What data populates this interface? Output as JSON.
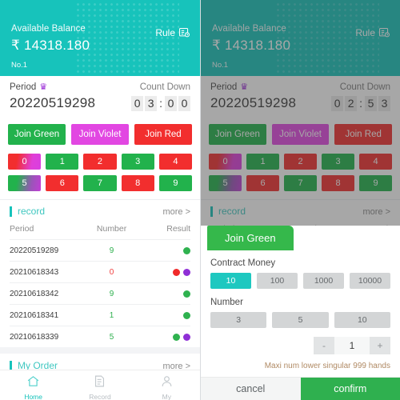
{
  "header": {
    "balance_label": "Available Balance",
    "balance_amount": "₹ 14318.180",
    "account_no": "No.1",
    "rule_label": "Rule",
    "rule_icon": "rule-document-clock-icon"
  },
  "period": {
    "period_label": "Period",
    "crown_icon": "crown-icon",
    "countdown_label": "Count Down",
    "period_number": "20220519298",
    "countdown_left": [
      "0",
      "3",
      "0",
      "0"
    ],
    "countdown_right": [
      "0",
      "2",
      "5",
      "3"
    ]
  },
  "join_buttons": [
    {
      "label": "Join Green",
      "class": "jg",
      "name": "join-green-button"
    },
    {
      "label": "Join Violet",
      "class": "jv",
      "name": "join-violet-button"
    },
    {
      "label": "Join Red",
      "class": "jr",
      "name": "join-red-button"
    }
  ],
  "numbers": [
    {
      "label": "0",
      "class": "n-vr"
    },
    {
      "label": "1",
      "class": "n-green"
    },
    {
      "label": "2",
      "class": "n-red"
    },
    {
      "label": "3",
      "class": "n-green"
    },
    {
      "label": "4",
      "class": "n-red"
    },
    {
      "label": "5",
      "class": "n-vg"
    },
    {
      "label": "6",
      "class": "n-red"
    },
    {
      "label": "7",
      "class": "n-green"
    },
    {
      "label": "8",
      "class": "n-red"
    },
    {
      "label": "9",
      "class": "n-green"
    }
  ],
  "record": {
    "title": "record",
    "more": "more >",
    "columns": [
      "Period",
      "Number",
      "Result"
    ],
    "rows": [
      {
        "period": "20220519289",
        "number": "9",
        "number_color": "num-g",
        "dots": [
          "d-green"
        ]
      },
      {
        "period": "20210618343",
        "number": "0",
        "number_color": "num-r",
        "dots": [
          "d-red",
          "d-violet"
        ]
      },
      {
        "period": "20210618342",
        "number": "9",
        "number_color": "num-g",
        "dots": [
          "d-green"
        ]
      },
      {
        "period": "20210618341",
        "number": "1",
        "number_color": "num-g",
        "dots": [
          "d-green"
        ]
      },
      {
        "period": "20210618339",
        "number": "5",
        "number_color": "num-g",
        "dots": [
          "d-green",
          "d-violet"
        ]
      }
    ]
  },
  "my_order": {
    "title": "My Order",
    "more": "more >"
  },
  "bottom_nav": [
    {
      "label": "Home",
      "icon": "home-icon",
      "active": true
    },
    {
      "label": "Record",
      "icon": "document-icon",
      "active": false
    },
    {
      "label": "My",
      "icon": "person-icon",
      "active": false
    }
  ],
  "modal": {
    "tab_label": "Join Green",
    "contract_money_label": "Contract Money",
    "contract_money_options": [
      "10",
      "100",
      "1000",
      "10000"
    ],
    "contract_money_selected": "10",
    "number_label": "Number",
    "number_options": [
      "3",
      "5",
      "10"
    ],
    "number_selected": null,
    "stepper_minus": "-",
    "stepper_value": "1",
    "stepper_plus": "+",
    "hint": "Maxi num lower singular 999 hands",
    "cancel_label": "cancel",
    "confirm_label": "confirm"
  },
  "colors": {
    "teal": "#17c3bb",
    "green": "#22b24c",
    "violet": "#e247e2",
    "red": "#f22e2e",
    "dot_violet": "#8f2fd6"
  }
}
